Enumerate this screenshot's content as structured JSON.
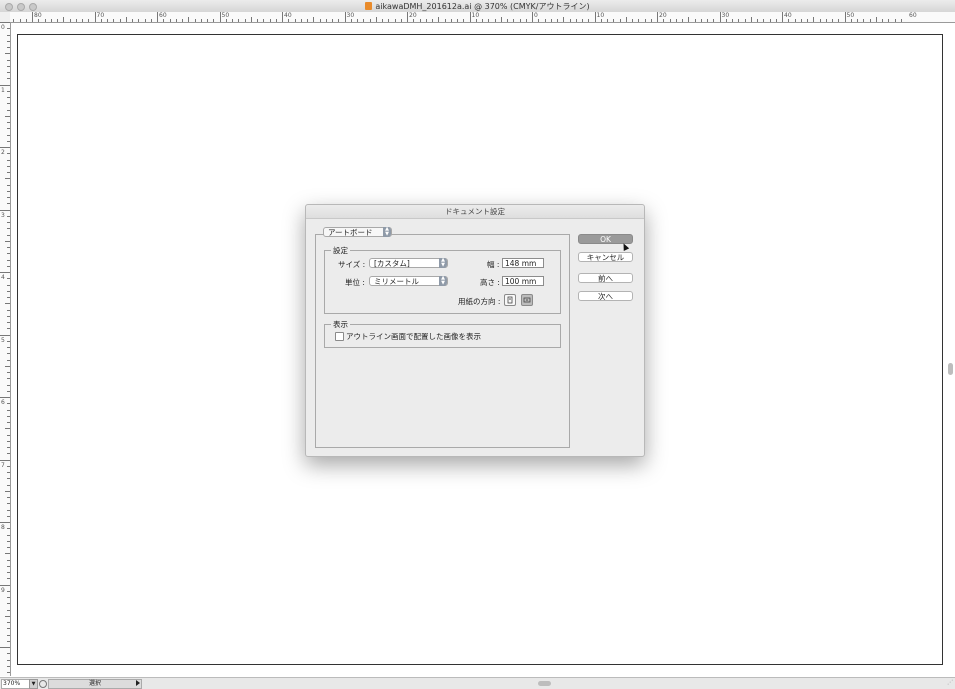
{
  "window": {
    "title": "aikawaDMH_201612a.ai @ 370% (CMYK/アウトライン)"
  },
  "rulers": {
    "horizontal_labels": [
      "80",
      "70",
      "60",
      "50",
      "40",
      "30",
      "20",
      "10",
      "0",
      "10",
      "20",
      "30",
      "40",
      "50",
      "60"
    ],
    "vertical_labels": [
      "0",
      "1",
      "2",
      "3",
      "4",
      "5",
      "6",
      "7",
      "8",
      "9"
    ]
  },
  "statusbar": {
    "zoom": "370%",
    "tool": "選択"
  },
  "dialog": {
    "title": "ドキュメント設定",
    "category": "アートボード",
    "settings": {
      "legend": "設定",
      "size_label": "サイズ :",
      "size_value": "[カスタム]",
      "unit_label": "単位 :",
      "unit_value": "ミリメートル",
      "width_label": "幅 :",
      "width_value": "148 mm",
      "height_label": "高さ :",
      "height_value": "100 mm",
      "orientation_label": "用紙の方向 :",
      "orientation_selected": "landscape"
    },
    "display": {
      "legend": "表示",
      "checkbox_label": "アウトライン画面で配置した画像を表示",
      "checked": false
    },
    "buttons": {
      "ok": "OK",
      "cancel": "キャンセル",
      "prev": "前へ",
      "next": "次へ"
    }
  }
}
